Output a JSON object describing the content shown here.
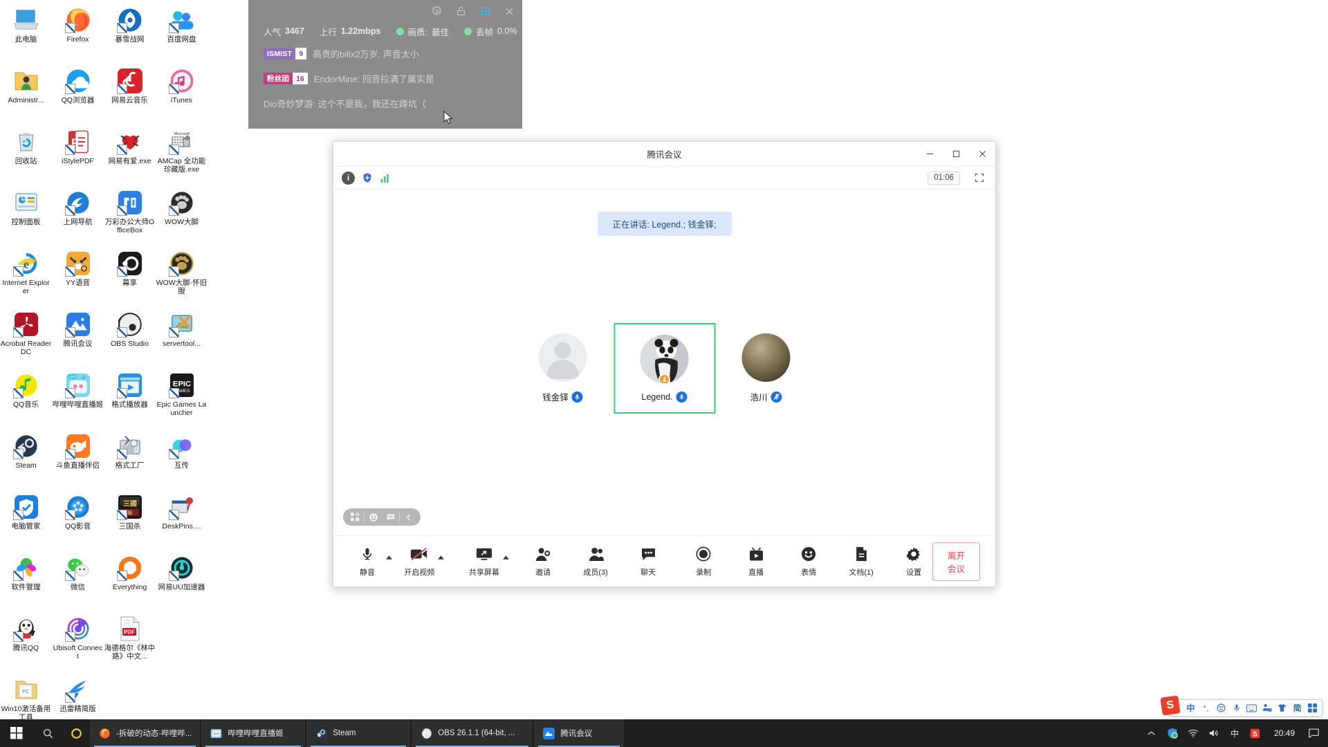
{
  "desktop": {
    "icons": [
      {
        "label": "此电脑",
        "icon": "computer-icon",
        "shortcut": false
      },
      {
        "label": "Firefox",
        "icon": "firefox-icon",
        "shortcut": true
      },
      {
        "label": "暴雪战网",
        "icon": "battlenet-icon",
        "shortcut": true
      },
      {
        "label": "百度网盘",
        "icon": "baidu-netdisk-icon",
        "shortcut": true
      },
      {
        "label": "Administr...",
        "icon": "user-folder-icon",
        "shortcut": false
      },
      {
        "label": "QQ浏览器",
        "icon": "qq-browser-icon",
        "shortcut": true
      },
      {
        "label": "网易云音乐",
        "icon": "netease-music-icon",
        "shortcut": true
      },
      {
        "label": "iTunes",
        "icon": "itunes-icon",
        "shortcut": true
      },
      {
        "label": "回收站",
        "icon": "recycle-bin-icon",
        "shortcut": false
      },
      {
        "label": "iStylePDF",
        "icon": "istylepdf-icon",
        "shortcut": true
      },
      {
        "label": "网易有爱.exe",
        "icon": "netease-youai-icon",
        "shortcut": true
      },
      {
        "label": "AMCap 全功能珍藏版.exe",
        "icon": "amcap-icon",
        "shortcut": true
      },
      {
        "label": "控制面板",
        "icon": "control-panel-icon",
        "shortcut": false
      },
      {
        "label": "上网导航",
        "icon": "web-nav-icon",
        "shortcut": true
      },
      {
        "label": "万彩办公大师OfficeBox",
        "icon": "officebox-icon",
        "shortcut": true
      },
      {
        "label": "WOW大脚",
        "icon": "wow-bigfoot-icon",
        "shortcut": true
      },
      {
        "label": "Internet Explorer",
        "icon": "internet-explorer-icon",
        "shortcut": true
      },
      {
        "label": "YY语音",
        "icon": "yy-voice-icon",
        "shortcut": true
      },
      {
        "label": "幕享",
        "icon": "letsview-icon",
        "shortcut": true
      },
      {
        "label": "WOW大脚-怀旧服",
        "icon": "wow-bigfoot-classic-icon",
        "shortcut": true
      },
      {
        "label": "Acrobat Reader DC",
        "icon": "acrobat-reader-icon",
        "shortcut": true
      },
      {
        "label": "腾讯会议",
        "icon": "tencent-meeting-icon",
        "shortcut": true
      },
      {
        "label": "OBS Studio",
        "icon": "obs-studio-icon",
        "shortcut": true
      },
      {
        "label": "servertool...",
        "icon": "servertool-icon",
        "shortcut": true
      },
      {
        "label": "QQ音乐",
        "icon": "qq-music-icon",
        "shortcut": true
      },
      {
        "label": "哔哩哔哩直播姬",
        "icon": "bilibili-live-icon",
        "shortcut": true
      },
      {
        "label": "格式播放器",
        "icon": "format-player-icon",
        "shortcut": true
      },
      {
        "label": "Epic Games Launcher",
        "icon": "epic-games-icon",
        "shortcut": true
      },
      {
        "label": "Steam",
        "icon": "steam-icon",
        "shortcut": true
      },
      {
        "label": "斗鱼直播伴侣",
        "icon": "douyu-live-icon",
        "shortcut": true
      },
      {
        "label": "格式工厂",
        "icon": "format-factory-icon",
        "shortcut": true
      },
      {
        "label": "互传",
        "icon": "hutrans-icon",
        "shortcut": true
      },
      {
        "label": "电脑管家",
        "icon": "pc-manager-icon",
        "shortcut": true
      },
      {
        "label": "QQ影音",
        "icon": "qq-player-icon",
        "shortcut": true
      },
      {
        "label": "三国杀",
        "icon": "sanguosha-icon",
        "shortcut": true
      },
      {
        "label": "DeskPins....",
        "icon": "deskpins-icon",
        "shortcut": true
      },
      {
        "label": "软件管理",
        "icon": "software-manager-icon",
        "shortcut": true
      },
      {
        "label": "微信",
        "icon": "wechat-icon",
        "shortcut": true
      },
      {
        "label": "Everything",
        "icon": "everything-icon",
        "shortcut": true
      },
      {
        "label": "网易UU加速器",
        "icon": "netease-uu-icon",
        "shortcut": true
      },
      {
        "label": "腾讯QQ",
        "icon": "tencent-qq-icon",
        "shortcut": true
      },
      {
        "label": "Ubisoft Connect",
        "icon": "ubisoft-connect-icon",
        "shortcut": true
      },
      {
        "label": "海德格尔《林中路》中文...",
        "icon": "pdf-document-icon",
        "shortcut": false
      },
      {
        "label": "",
        "icon": "",
        "shortcut": false
      },
      {
        "label": "Win10激活备用工具",
        "icon": "folder-icon",
        "shortcut": false
      },
      {
        "label": "迅雷精简版",
        "icon": "thunder-lite-icon",
        "shortcut": true
      }
    ]
  },
  "stream_overlay": {
    "titlebar_icons": [
      "gear-icon",
      "unlock-icon",
      "picture-in-picture-icon",
      "close-icon"
    ],
    "stats": [
      {
        "name": "人气",
        "value": "3467",
        "dot": false
      },
      {
        "name": "上行",
        "value": "1.22mbps",
        "dot": false
      },
      {
        "name": "画质:",
        "value": "最佳",
        "dot": true
      },
      {
        "name": "丢帧",
        "value": "0.0%",
        "dot": true
      }
    ],
    "chat": [
      {
        "badge_name": "ISMIST",
        "badge_level": "9",
        "badge_color": "#8e6fb8",
        "level_color": "#6e5594",
        "user": "高贵的bilix2万岁",
        "text": "声音太小"
      },
      {
        "badge_name": "粉丝团",
        "badge_level": "16",
        "badge_color": "#c93c7a",
        "level_color": "#b02c68",
        "user": "EndorMine",
        "text": "回音拉满了属实是"
      },
      {
        "badge_name": "",
        "badge_level": "",
        "badge_color": "",
        "level_color": "",
        "user": "Dio奇妙梦游",
        "text": "这个不是我，我还在蹲坑（"
      }
    ]
  },
  "meeting": {
    "title": "腾讯会议",
    "window_controls": [
      "minimize-icon",
      "maximize-icon",
      "close-icon"
    ],
    "subbar_icons": [
      "info-icon",
      "shield-icon",
      "signal-icon"
    ],
    "timer": "01:06",
    "fullscreen_icon": "fullscreen-icon",
    "speaking_banner": "正在讲话: Legend.; 钱金铎;",
    "participants": [
      {
        "name": "钱金铎",
        "avatar": "default-avatar",
        "mic": "unmuted",
        "active": false,
        "host": false
      },
      {
        "name": "Legend.",
        "avatar": "panda-avatar",
        "mic": "unmuted",
        "active": true,
        "host": true
      },
      {
        "name": "浩川",
        "avatar": "moon-avatar",
        "mic": "muted",
        "active": false,
        "host": false
      }
    ],
    "float_pill": [
      "layout-grid-icon",
      "emoji-icon",
      "chat-bubble-icon",
      "collapse-chevron-icon"
    ],
    "toolbar": [
      {
        "label": "静音",
        "icon": "microphone-icon",
        "caret": true
      },
      {
        "label": "开启视频",
        "icon": "video-off-icon",
        "caret": true
      },
      {
        "label": "共享屏幕",
        "icon": "share-screen-icon",
        "caret": true
      },
      {
        "label": "邀请",
        "icon": "invite-user-icon",
        "caret": false
      },
      {
        "label": "成员(3)",
        "icon": "members-icon",
        "caret": false
      },
      {
        "label": "聊天",
        "icon": "chat-icon",
        "caret": false
      },
      {
        "label": "录制",
        "icon": "record-icon",
        "caret": false
      },
      {
        "label": "直播",
        "icon": "live-broadcast-icon",
        "caret": false
      },
      {
        "label": "表情",
        "icon": "emoji-face-icon",
        "caret": false
      },
      {
        "label": "文档(1)",
        "icon": "document-icon",
        "caret": false
      },
      {
        "label": "设置",
        "icon": "gear-icon",
        "caret": false
      }
    ],
    "leave_label": "离开会议"
  },
  "taskbar": {
    "start_icon": "windows-start-icon",
    "search_icon": "search-icon",
    "cortana_icon": "cortana-icon",
    "apps": [
      {
        "title": "-拆破的动态-哔哩哔...",
        "icon": "firefox-icon"
      },
      {
        "title": "哔哩哔哩直播姬",
        "icon": "bilibili-live-icon"
      },
      {
        "title": "Steam",
        "icon": "steam-icon"
      },
      {
        "title": "OBS 26.1.1 (64-bit, ...",
        "icon": "obs-studio-icon"
      },
      {
        "title": "腾讯会议",
        "icon": "tencent-meeting-icon"
      }
    ],
    "tray": [
      "chevron-up-icon",
      "pc-manager-tray-icon",
      "wifi-icon",
      "volume-icon",
      "ime-chinese-icon",
      "sogou-ime-icon"
    ],
    "ime_label": "中",
    "clock": "20:49",
    "notification_icon": "notification-icon"
  },
  "ime_bar": {
    "logo": "sogou-logo-icon",
    "items": [
      "中",
      "°,",
      "smiley-icon",
      "microphone-icon",
      "keyboard-icon",
      "toolbox-icon",
      "skin-icon",
      "简",
      "panel-icon"
    ]
  }
}
